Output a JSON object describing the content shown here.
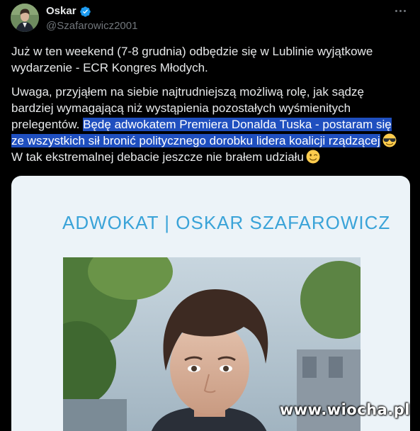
{
  "author": {
    "display_name": "Oskar",
    "handle": "@Szafarowicz2001",
    "verified_icon": "verified-badge-icon",
    "accent_color": "#1d9bf0"
  },
  "tweet": {
    "paragraph1": [
      "Już w ten weekend (7-8 grudnia) odbędzie się w Lublinie wyjątkowe",
      "wydarzenie - ECR Kongres Młodych."
    ],
    "paragraph2": {
      "line1": "Uwaga, przyjąłem na siebie najtrudniejszą możliwą rolę, jak sądzę",
      "line2": "bardziej wymagającą niż wystąpienia pozostałych wyśmienitych",
      "line3_plain": "prelegentów. ",
      "line3_highlight": "Będę adwokatem Premiera Donalda Tuska - postaram się",
      "line4_highlight": "ze wszystkich sił bronić politycznego dorobku lidera koalicji rządzącej",
      "line4_emoji": "smiling-face-with-sunglasses-icon",
      "line5": "W tak ekstremalnej debacie jeszcze nie brałem udziału",
      "line5_emoji": "winking-face-icon"
    },
    "highlight_color": "#1f4fbf"
  },
  "media": {
    "card_title": "ADWOKAT | OSKAR SZAFAROWICZ",
    "card_title_color": "#3aa3d8",
    "card_background": "#ecf3f8"
  },
  "watermark": "www.wiocha.pl",
  "icons": {
    "more": "more-options-icon"
  }
}
